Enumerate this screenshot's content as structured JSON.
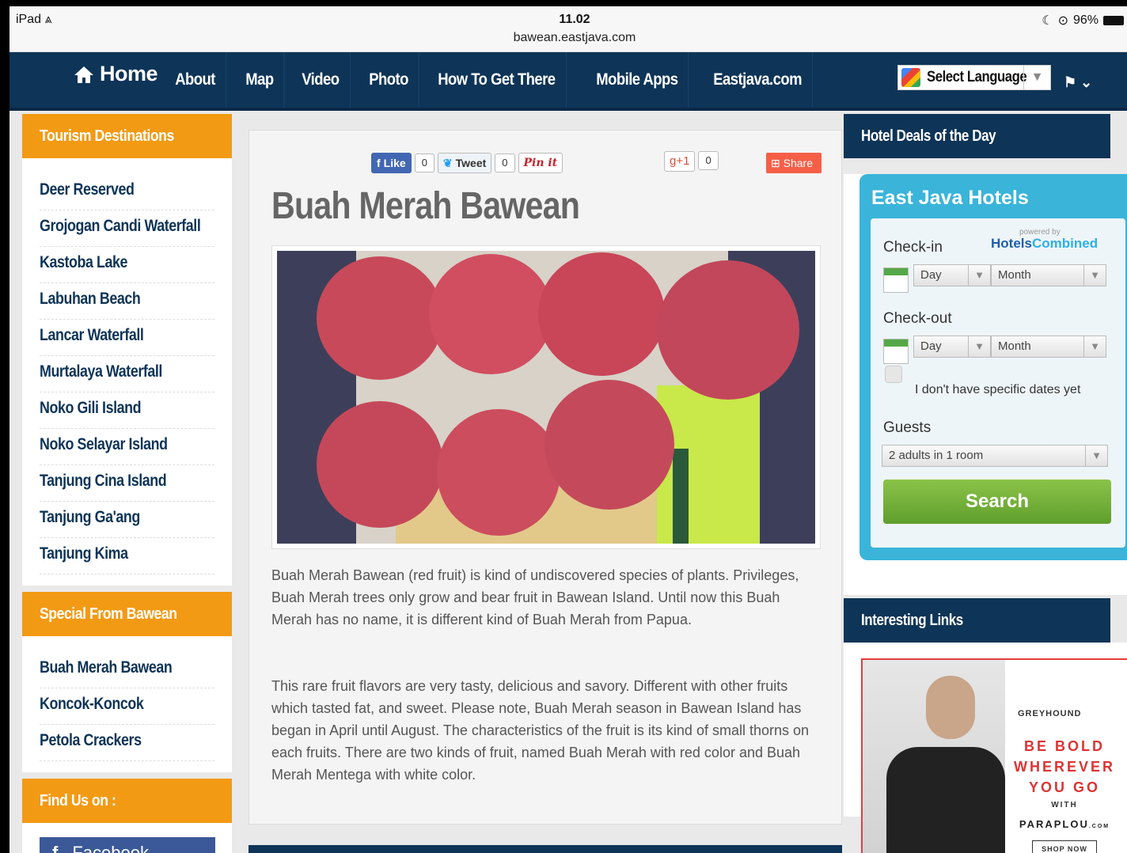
{
  "status": {
    "device": "iPad",
    "time": "11.02",
    "url": "bawean.eastjava.com",
    "battery": "96%"
  },
  "nav": {
    "home": "Home",
    "items": [
      "About",
      "Map",
      "Video",
      "Photo",
      "How To Get There",
      "Mobile Apps",
      "Eastjava.com"
    ],
    "language": "Select Language"
  },
  "left": {
    "tourism_title": "Tourism Destinations",
    "tourism_items": [
      "Deer Reserved",
      "Grojogan Candi Waterfall",
      "Kastoba Lake",
      "Labuhan Beach",
      "Lancar Waterfall",
      "Murtalaya Waterfall",
      "Noko Gili Island",
      "Noko Selayar Island",
      "Tanjung Cina Island",
      "Tanjung Ga'ang",
      "Tanjung Kima"
    ],
    "special_title": "Special From Bawean",
    "special_items": [
      "Buah Merah Bawean",
      "Koncok-Koncok",
      "Petola Crackers"
    ],
    "find_title": "Find Us on :",
    "facebook": "Facebook"
  },
  "article": {
    "share": {
      "like": "Like",
      "like_count": "0",
      "tweet": "Tweet",
      "tweet_count": "0",
      "pin": "Pin it",
      "gplus": "+1",
      "gplus_count": "0",
      "share": "Share"
    },
    "title": "Buah Merah Bawean",
    "para1": "Buah Merah Bawean (red fruit) is kind of undiscovered species of plants. Privileges, Buah Merah trees only grow and bear fruit in Bawean Island. Until now this Buah Merah has no name, it is different kind of Buah Merah from Papua.",
    "para2": "This rare fruit flavors are very tasty, delicious and savory. Different with other fruits which tasted fat, and sweet. Please note, Buah Merah season in Bawean Island has began in April until August. The characteristics of the fruit is its kind of small thorns on each fruits. There are two kinds of fruit, named Buah Merah with red color and Buah Merah Mentega with white color."
  },
  "right": {
    "hotel_deals_title": "Hotel Deals of the Day",
    "widget": {
      "title": "East Java Hotels",
      "powered_by": "powered by",
      "brand_a": "Hotels",
      "brand_b": "Combined",
      "checkin": "Check-in",
      "checkout": "Check-out",
      "day": "Day",
      "month": "Month",
      "no_dates": "I don't have specific dates yet",
      "guests": "Guests",
      "guests_value": "2 adults in 1 room",
      "search": "Search"
    },
    "links_title": "Interesting Links",
    "ad": {
      "brand": "GREYHOUND",
      "line1": "BE BOLD",
      "line2": "WHEREVER",
      "line3": "YOU GO",
      "with": "WITH",
      "site": "PARAPLOU",
      "site_suffix": ".COM",
      "cta": "SHOP NOW"
    }
  },
  "colors": {
    "navy": "#0e3457",
    "orange": "#f39a14",
    "hotel_blue": "#3ab4d9",
    "search_green": "#6fb33a"
  }
}
